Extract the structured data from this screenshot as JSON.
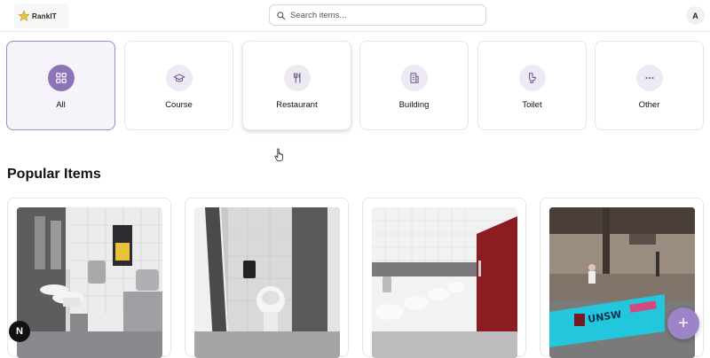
{
  "header": {
    "logo_text": "RankIT",
    "search_placeholder": "Search items...",
    "avatar_initial": "A"
  },
  "categories": [
    {
      "label": "All",
      "icon": "grid-icon",
      "active": true
    },
    {
      "label": "Course",
      "icon": "graduation-cap-icon",
      "active": false
    },
    {
      "label": "Restaurant",
      "icon": "fork-knife-icon",
      "active": false
    },
    {
      "label": "Building",
      "icon": "building-icon",
      "active": false
    },
    {
      "label": "Toilet",
      "icon": "toilet-icon",
      "active": false
    },
    {
      "label": "Other",
      "icon": "more-dots-icon",
      "active": false
    }
  ],
  "popular": {
    "title": "Popular Items",
    "items": [
      {
        "image": "bathroom-sinks-photo"
      },
      {
        "image": "toilet-stall-photo"
      },
      {
        "image": "sinks-red-door-photo"
      },
      {
        "image": "unsw-building-photo"
      }
    ]
  },
  "badge_text": "N",
  "fab_label": "+",
  "colors": {
    "accent": "#8d73b8",
    "accent_light": "#f6f3fb",
    "fab": "#9d84c9"
  }
}
